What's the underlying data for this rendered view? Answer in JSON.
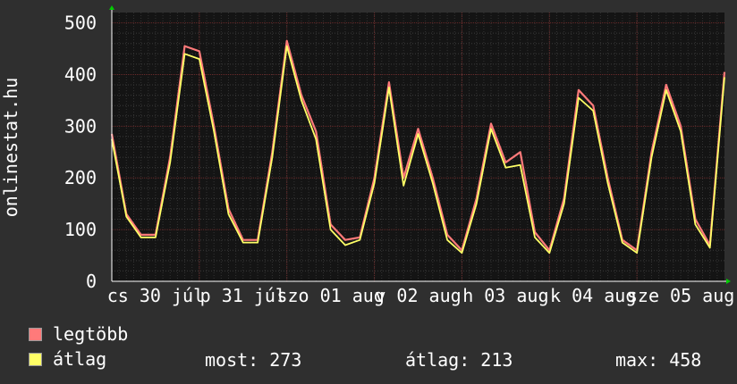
{
  "chart_data": {
    "type": "line",
    "ylabel": "onlinestat.hu",
    "ylim": [
      0,
      520
    ],
    "yticks": [
      "0",
      "100",
      "200",
      "300",
      "400",
      "500"
    ],
    "grid": true,
    "x_day_labels": [
      "cs 30 júl",
      "p 31 júl",
      "szo 01 aug",
      "v 02 aug",
      "h 03 aug",
      "k 04 aug",
      "sze 05 aug"
    ],
    "x_hours": [
      0,
      4,
      8,
      12,
      16,
      20,
      24,
      28,
      32,
      36,
      40,
      44,
      48,
      52,
      56,
      60,
      64,
      68,
      72,
      76,
      80,
      84,
      88,
      92,
      96,
      100,
      104,
      108,
      112,
      116,
      120,
      124,
      128,
      132,
      136,
      140,
      144,
      148,
      152,
      156,
      160,
      164,
      168
    ],
    "series": [
      {
        "name": "legtöbb",
        "color": "#ff7a7a",
        "values": [
          285,
          130,
          90,
          90,
          240,
          455,
          445,
          300,
          140,
          80,
          80,
          250,
          465,
          360,
          290,
          110,
          80,
          85,
          200,
          385,
          200,
          295,
          200,
          90,
          60,
          160,
          305,
          230,
          250,
          95,
          60,
          160,
          370,
          340,
          200,
          80,
          60,
          250,
          380,
          300,
          120,
          70,
          405
        ]
      },
      {
        "name": "átlag",
        "color": "#ffff66",
        "values": [
          275,
          125,
          85,
          85,
          230,
          440,
          430,
          290,
          130,
          75,
          75,
          240,
          455,
          350,
          275,
          100,
          70,
          80,
          190,
          375,
          185,
          285,
          190,
          80,
          55,
          150,
          295,
          220,
          225,
          85,
          55,
          150,
          355,
          330,
          190,
          75,
          55,
          240,
          370,
          290,
          110,
          65,
          395
        ]
      }
    ]
  },
  "legend": [
    {
      "label": "legtöbb",
      "color": "#ff7a7a"
    },
    {
      "label": "átlag",
      "color": "#ffff66"
    }
  ],
  "stats": {
    "most": "most: 273",
    "atlag": "átlag: 213",
    "max": "max: 458"
  }
}
